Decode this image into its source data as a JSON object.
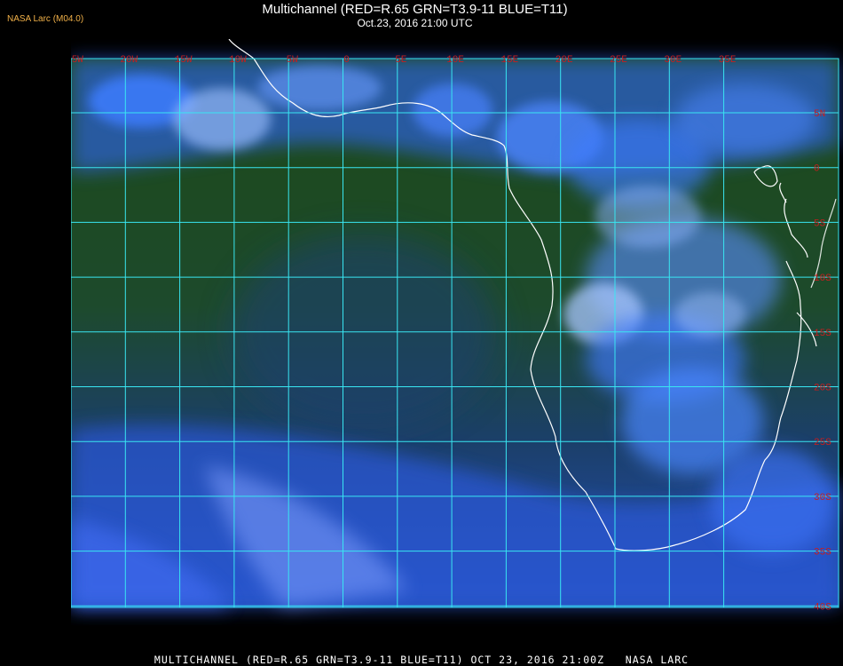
{
  "header": {
    "credit": "NASA Larc (M04.0)",
    "title": "Multichannel (RED=R.65 GRN=T3.9-11 BLUE=T11)",
    "subtitle": "Oct.23, 2016 21:00 UTC"
  },
  "map": {
    "longitude_labels": [
      "25W",
      "20W",
      "15W",
      "10W",
      "5W",
      "0",
      "5E",
      "10E",
      "15E",
      "20E",
      "25E",
      "30E",
      "35E"
    ],
    "latitude_labels": [
      "5N",
      "0",
      "5S",
      "10S",
      "15S",
      "20S",
      "25S",
      "30S",
      "35S",
      "40S"
    ],
    "colors": {
      "ocean": "#1f4f1a",
      "cloud": "#3a74ff",
      "cloud_bright": "#a9c8ff",
      "grid": "#39e6f2",
      "label": "#c81e1e",
      "coast": "#ffffff"
    }
  },
  "footer": {
    "text": "MULTICHANNEL (RED=R.65 GRN=T3.9-11 BLUE=T11) OCT 23, 2016 21:00Z   NASA LARC"
  }
}
